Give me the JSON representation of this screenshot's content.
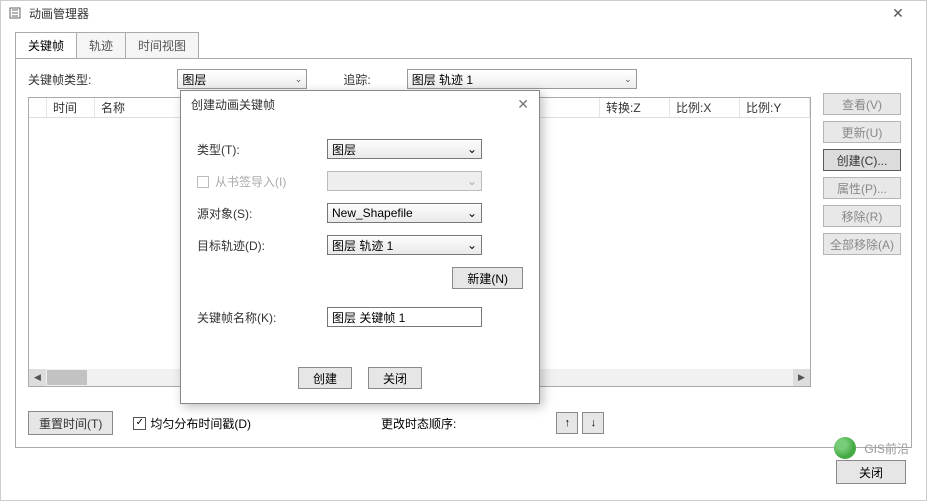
{
  "window": {
    "title": "动画管理器"
  },
  "tabs": [
    "关键帧",
    "轨迹",
    "时间视图"
  ],
  "filters": {
    "type_label": "关键帧类型:",
    "type_value": "图层",
    "track_label": "追踪:",
    "track_value": "图层 轨迹 1"
  },
  "columns": {
    "time": "时间",
    "name": "名称",
    "transformZ": "转换:Z",
    "scaleX": "比例:X",
    "scaleY": "比例:Y"
  },
  "side_buttons": {
    "view": "查看(V)",
    "update": "更新(U)",
    "create": "创建(C)...",
    "properties": "属性(P)...",
    "remove": "移除(R)",
    "remove_all": "全部移除(A)"
  },
  "bottom": {
    "reset": "重置时间(T)",
    "distribute": "均匀分布时间戳(D)",
    "change_order": "更改时态顺序:"
  },
  "footer": {
    "close": "关闭"
  },
  "dialog": {
    "title": "创建动画关键帧",
    "type_label": "类型(T):",
    "type_value": "图层",
    "import_label": "从书签导入(I)",
    "source_label": "源对象(S):",
    "source_value": "New_Shapefile",
    "target_label": "目标轨迹(D):",
    "target_value": "图层 轨迹 1",
    "new_btn": "新建(N)",
    "name_label": "关键帧名称(K):",
    "name_value": "图层 关键帧 1",
    "create_btn": "创建",
    "close_btn": "关闭"
  },
  "watermark": "GIS前沿",
  "icons": {
    "up": "↑",
    "down": "↓",
    "close": "✕",
    "caret": "⌄",
    "left": "◀",
    "right": "▶"
  }
}
